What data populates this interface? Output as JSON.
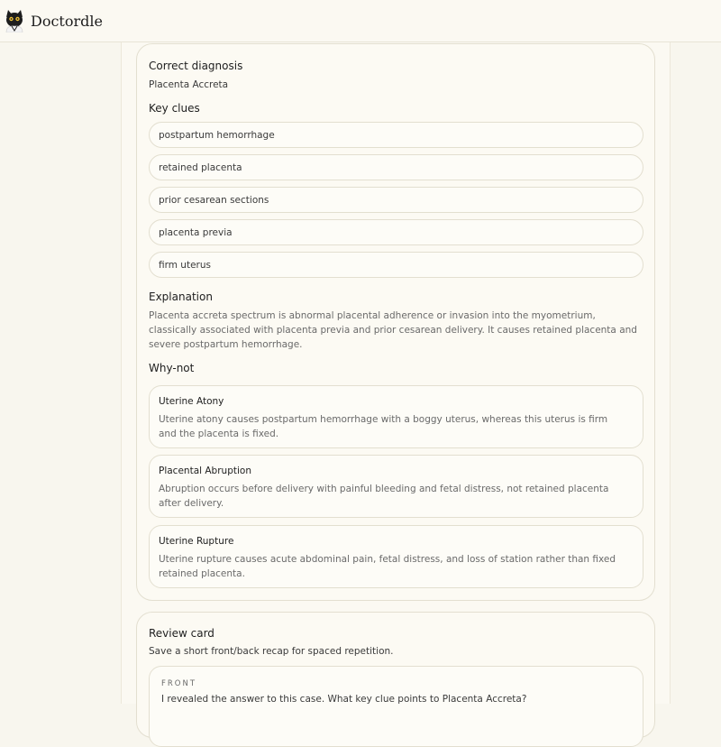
{
  "app": {
    "title": "Doctordle"
  },
  "answer": {
    "diagnosis_heading": "Correct diagnosis",
    "diagnosis": "Placenta Accreta",
    "clues_heading": "Key clues",
    "clues": [
      "postpartum hemorrhage",
      "retained placenta",
      "prior cesarean sections",
      "placenta previa",
      "firm uterus"
    ],
    "explanation_heading": "Explanation",
    "explanation": "Placenta accreta spectrum is abnormal placental adherence or invasion into the myometrium, classically associated with placenta previa and prior cesarean delivery. It causes retained placenta and severe postpartum hemorrhage.",
    "why_not_heading": "Why-not",
    "why_not": [
      {
        "title": "Uterine Atony",
        "text": "Uterine atony causes postpartum hemorrhage with a boggy uterus, whereas this uterus is firm and the placenta is fixed."
      },
      {
        "title": "Placental Abruption",
        "text": "Abruption occurs before delivery with painful bleeding and fetal distress, not retained placenta after delivery."
      },
      {
        "title": "Uterine Rupture",
        "text": "Uterine rupture causes acute abdominal pain, fetal distress, and loss of station rather than fixed retained placenta."
      }
    ]
  },
  "review": {
    "heading": "Review card",
    "subtitle": "Save a short front/back recap for spaced repetition.",
    "front_label": "FRONT",
    "front_text": "I revealed the answer to this case. What key clue points to Placenta Accreta?"
  }
}
